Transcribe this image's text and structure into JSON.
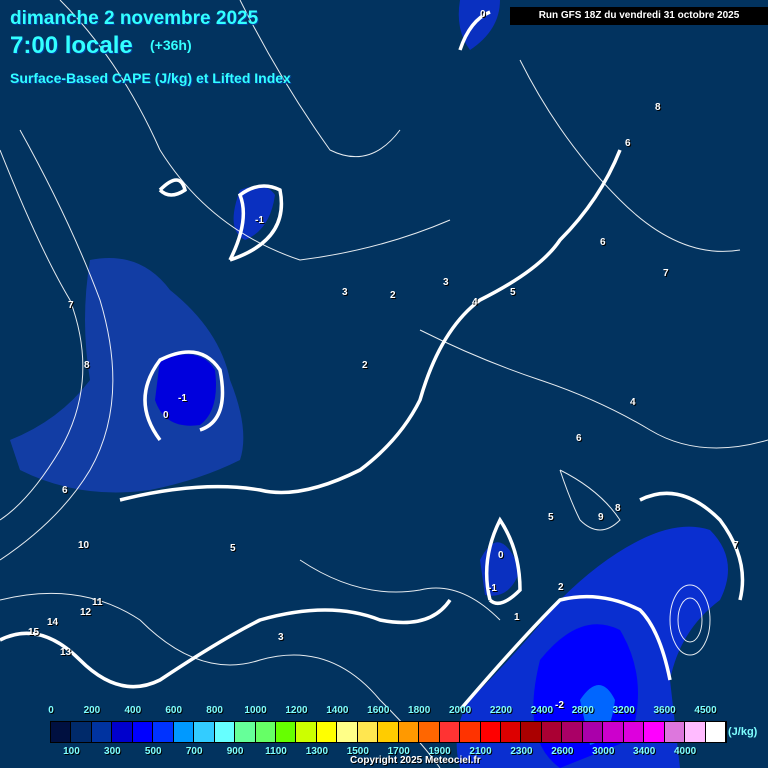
{
  "header": {
    "date": "dimanche 2 novembre 2025",
    "time": "7:00 locale",
    "lead": "(+36h)",
    "parameter": "Surface-Based CAPE (J/kg) et Lifted Index",
    "run": "Run GFS 18Z du vendredi 31 octobre 2025"
  },
  "legend": {
    "top_labels": [
      "0",
      "200",
      "400",
      "600",
      "800",
      "1000",
      "1200",
      "1400",
      "1600",
      "1800",
      "2000",
      "2200",
      "2400",
      "2800",
      "3200",
      "3600",
      "4500"
    ],
    "bottom_labels": [
      "100",
      "300",
      "500",
      "700",
      "900",
      "1100",
      "1300",
      "1500",
      "1700",
      "1900",
      "2100",
      "2300",
      "2600",
      "3000",
      "3400",
      "4000"
    ],
    "colors": [
      "#001040",
      "#002a6a",
      "#0033a0",
      "#0000cc",
      "#0000ff",
      "#0033ff",
      "#0099ff",
      "#33ccff",
      "#66ffff",
      "#66ff99",
      "#66ff66",
      "#66ff00",
      "#ccff00",
      "#ffff00",
      "#ffff88",
      "#ffe650",
      "#ffcc00",
      "#ff9900",
      "#ff6600",
      "#ff3333",
      "#ff3300",
      "#ff0000",
      "#dd0000",
      "#aa0000",
      "#aa0033",
      "#aa0066",
      "#aa00aa",
      "#cc00cc",
      "#dd00dd",
      "#ff00ff",
      "#dd77dd",
      "#ffbbff",
      "#ffffff"
    ],
    "unit": "(J/kg)"
  },
  "copyright": "Copyright 2025 Meteociel.fr",
  "li_labels": [
    "0",
    "-1",
    "-1",
    "0",
    "2",
    "3",
    "2",
    "3",
    "4",
    "5",
    "6",
    "7",
    "8",
    "-1",
    "0",
    "1",
    "2",
    "5",
    "6",
    "8",
    "9",
    "4",
    "6",
    "7",
    "10",
    "11",
    "12",
    "13",
    "14",
    "15",
    "-2",
    "6",
    "7",
    "8",
    "5",
    "3"
  ]
}
